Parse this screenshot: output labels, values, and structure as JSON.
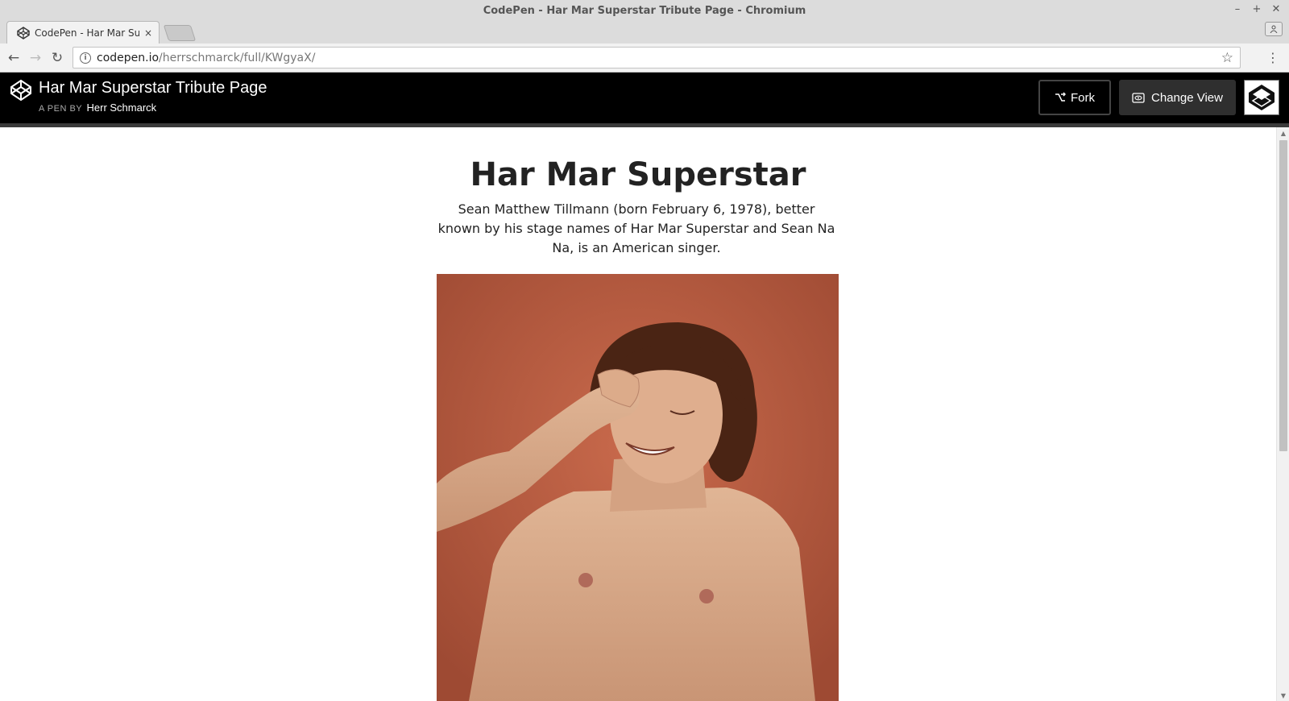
{
  "window": {
    "title": "CodePen - Har Mar Superstar Tribute Page - Chromium",
    "controls": [
      "–",
      "+",
      "✕"
    ]
  },
  "tab": {
    "title": "CodePen - Har Mar Sup",
    "close": "×"
  },
  "address_bar": {
    "host": "codepen.io",
    "path": "/herrschmarck/full/KWgyaX/"
  },
  "codepen": {
    "pen_title": "Har Mar Superstar Tribute Page",
    "byline_prefix": "A PEN BY",
    "author": "Herr Schmarck",
    "fork_label": "Fork",
    "change_view_label": "Change View"
  },
  "page": {
    "heading": "Har Mar Superstar",
    "intro": "Sean Matthew Tillmann (born February 6, 1978), better known by his stage names of Har Mar Superstar and Sean Na Na, is an American singer."
  },
  "colors": {
    "header_bg": "#000000",
    "photo_bg": "#b5583c",
    "skin": "#d9ad8c"
  }
}
